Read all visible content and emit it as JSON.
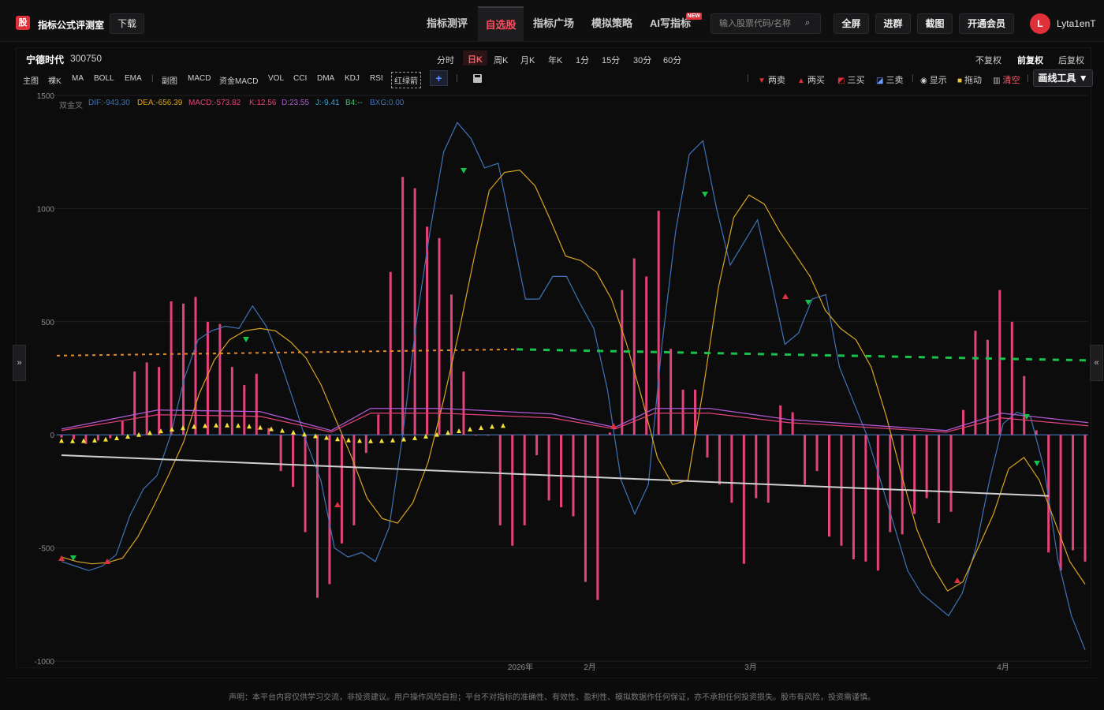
{
  "app": {
    "logo_char": "股",
    "brand": "指标公式评测室",
    "download": "下载"
  },
  "nav": [
    {
      "label": "指标测评",
      "active": false
    },
    {
      "label": "自选股",
      "active": true
    },
    {
      "label": "指标广场",
      "active": false
    },
    {
      "label": "模拟策略",
      "active": false
    },
    {
      "label": "AI写指标",
      "active": false,
      "badge": "NEW"
    }
  ],
  "search": {
    "placeholder": "输入股票代码/名称"
  },
  "top_buttons": [
    "全屏",
    "进群",
    "截图",
    "开通会员"
  ],
  "user": {
    "avatar_letter": "L",
    "name": "Lyta1enT"
  },
  "stock": {
    "name": "宁德时代",
    "code": "300750"
  },
  "periods": [
    "分时",
    "日K",
    "周K",
    "月K",
    "年K",
    "1分",
    "15分",
    "30分",
    "60分"
  ],
  "active_period": "日K",
  "adjust": [
    "不复权",
    "前复权",
    "后复权"
  ],
  "active_adjust": "前复权",
  "indicators": [
    "主图",
    "裸K",
    "MA",
    "BOLL",
    "EMA",
    "副图",
    "MACD",
    "资金MACD",
    "VOL",
    "CCI",
    "DMA",
    "KDJ",
    "RSI",
    "红绿箭"
  ],
  "tools": [
    "两卖",
    "两买",
    "三买",
    "三卖",
    "显示",
    "拖动",
    "清空"
  ],
  "draw_tools": "画线工具 ▼",
  "legend": [
    {
      "label": "双金叉",
      "color": "#7a7a7a"
    },
    {
      "label": "DIF:-943.30",
      "color": "#3f73b8"
    },
    {
      "label": "DEA:-656.39",
      "color": "#d9a520"
    },
    {
      "label": "MACD:-573.82",
      "color": "#e3437a"
    },
    {
      "label": "K:12.56",
      "color": "#e3437a"
    },
    {
      "label": "D:23.55",
      "color": "#b05ad6"
    },
    {
      "label": "J:-9.41",
      "color": "#2fa8e8"
    },
    {
      "label": "B4:--",
      "color": "#3cc46a"
    },
    {
      "label": "BXG:0.00",
      "color": "#3f73b8"
    }
  ],
  "colors": {
    "accent": "#e0303a",
    "macd_bar": "#e3437a",
    "dif": "#3f73b8",
    "dea": "#d9a520",
    "green": "#18c24a"
  },
  "chart_data": {
    "type": "line",
    "ylim": [
      -1000,
      1500
    ],
    "yticks": [
      1500,
      1000,
      500,
      0,
      -500,
      -1000
    ],
    "xticks": [
      "2026年",
      "2月",
      "3月",
      "4月"
    ],
    "macd": [
      -12,
      -20,
      -40,
      -25,
      -15,
      60,
      280,
      320,
      300,
      590,
      580,
      610,
      500,
      490,
      300,
      220,
      270,
      30,
      -160,
      -230,
      -430,
      -720,
      -660,
      -480,
      -400,
      -80,
      90,
      720,
      1140,
      1090,
      920,
      870,
      620,
      280,
      0,
      0,
      -400,
      -490,
      -400,
      -90,
      -290,
      -320,
      -360,
      -650,
      -730,
      10,
      640,
      780,
      700,
      990,
      380,
      200,
      200,
      -100,
      -220,
      -300,
      -570,
      -280,
      -300,
      130,
      100,
      -220,
      -160,
      -450,
      -490,
      -550,
      -560,
      -600,
      -430,
      -440,
      -350,
      -280,
      -390,
      -340,
      110,
      460,
      420,
      640,
      500,
      260,
      20,
      -520,
      -600,
      -510,
      -560
    ],
    "dif": [
      -560,
      -580,
      -600,
      -580,
      -530,
      -360,
      -240,
      -180,
      0,
      250,
      420,
      460,
      480,
      470,
      570,
      480,
      330,
      150,
      -40,
      -200,
      -500,
      -540,
      -520,
      -560,
      -410,
      0,
      500,
      900,
      1250,
      1380,
      1310,
      1180,
      1200,
      900,
      600,
      600,
      700,
      700,
      580,
      470,
      200,
      -200,
      -350,
      -220,
      400,
      900,
      1240,
      1300,
      1000,
      750,
      850,
      950,
      680,
      400,
      450,
      600,
      620,
      300,
      150,
      0,
      -200,
      -400,
      -600,
      -700,
      -750,
      -800,
      -700,
      -500,
      -200,
      50,
      100,
      80,
      -150,
      -550,
      -800,
      -950
    ],
    "dea": [
      -540,
      -560,
      -570,
      -565,
      -545,
      -450,
      -320,
      -180,
      -30,
      180,
      330,
      420,
      460,
      470,
      460,
      410,
      340,
      220,
      60,
      -100,
      -280,
      -370,
      -390,
      -300,
      -120,
      150,
      450,
      780,
      1080,
      1160,
      1170,
      1100,
      950,
      790,
      770,
      720,
      600,
      400,
      160,
      -100,
      -220,
      -200,
      200,
      650,
      960,
      1060,
      1020,
      900,
      800,
      700,
      550,
      470,
      420,
      300,
      80,
      -180,
      -420,
      -580,
      -690,
      -650,
      -500,
      -350,
      -150,
      -100,
      -200,
      -380,
      -560,
      -660
    ],
    "trendline": [
      -90,
      -270
    ],
    "price_line_level": 350,
    "kdj_level": 40
  }
}
